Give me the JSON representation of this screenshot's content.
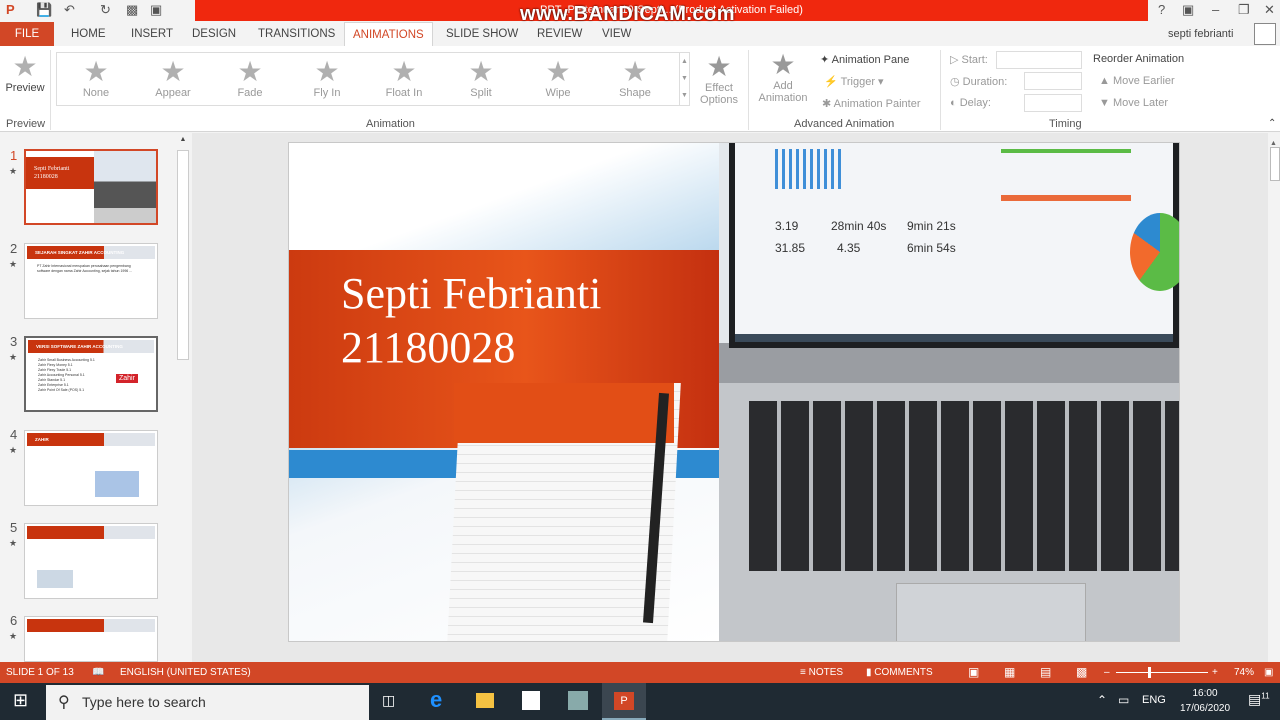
{
  "window": {
    "title": "PPT_Pertemuan10-Septi... (Product Activation Failed)",
    "watermark": "www.BANDICAM.com",
    "help": "?",
    "user": "septi febrianti"
  },
  "tabs": [
    "FILE",
    "HOME",
    "INSERT",
    "DESIGN",
    "TRANSITIONS",
    "ANIMATIONS",
    "SLIDE SHOW",
    "REVIEW",
    "VIEW"
  ],
  "ribbon": {
    "preview": {
      "label": "Preview",
      "group": "Preview"
    },
    "animation_group": "Animation",
    "gallery": [
      "None",
      "Appear",
      "Fade",
      "Fly In",
      "Float In",
      "Split",
      "Wipe",
      "Shape"
    ],
    "effect_options": [
      "Effect",
      "Options"
    ],
    "add_animation": [
      "Add",
      "Animation"
    ],
    "animation_pane": "Animation Pane",
    "trigger": "Trigger",
    "animation_painter": "Animation Painter",
    "advanced_group": "Advanced Animation",
    "start": "Start:",
    "duration": "Duration:",
    "delay": "Delay:",
    "timing_group": "Timing",
    "reorder": "Reorder Animation",
    "move_earlier": "Move Earlier",
    "move_later": "Move Later"
  },
  "slides": [
    {
      "num": "1",
      "title": "Septi Febrianti",
      "sub": "21180028"
    },
    {
      "num": "2",
      "title": "SEJARAH SINGKAT ZAHIR ACCOUNTING",
      "body": "PT Zahir Internasional merupakan perusahaan pengembang software dengan nama Zahir Accounting, sejak tahun 1996 ..."
    },
    {
      "num": "3",
      "title": "VERSI SOFTWARE ZAHIR ACCOUNTING",
      "items": [
        "Zahir Small Business Accounting 5.1",
        "Zahir Flexy Money 5.1",
        "Zahir Flexy Trade 5.1",
        "Zahir Accounting Personal 5.1",
        "Zahir Standar 5.1",
        "Zahir Enterprise 5.1",
        "Zahir Point Of Sale (POS) 5.1"
      ],
      "badge": "Zahir"
    },
    {
      "num": "4",
      "title": "ZAHIR"
    },
    {
      "num": "5",
      "title": ""
    },
    {
      "num": "6",
      "title": ""
    }
  ],
  "main_slide": {
    "name": "Septi Febrianti",
    "id": "21180028",
    "stats": [
      "3.19",
      "28min 40s",
      "9min 21s",
      "31.85",
      "4.35",
      "6min 54s"
    ]
  },
  "status": {
    "slide": "SLIDE 1 OF 13",
    "language": "ENGLISH (UNITED STATES)",
    "notes": "NOTES",
    "comments": "COMMENTS",
    "zoom": "74%"
  },
  "taskbar": {
    "search_placeholder": "Type here to search",
    "lang": "ENG",
    "time": "16:00",
    "date": "17/06/2020",
    "notifications": "11"
  },
  "colors": {
    "accent": "#d24726",
    "titlebar_red": "#f0280e",
    "taskbar": "#1f2a33"
  }
}
